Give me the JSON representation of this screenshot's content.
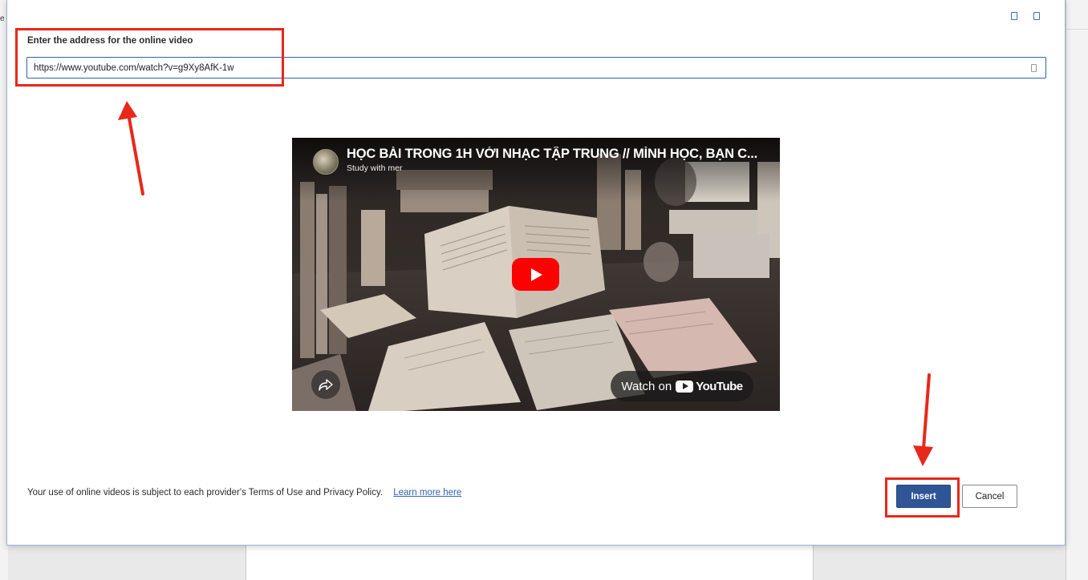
{
  "background": {
    "left_tab_stub": "e"
  },
  "dialog": {
    "window_icons": [
      "restore-icon",
      "close-icon"
    ],
    "address_label": "Enter the address for the online video",
    "url_value": "https://www.youtube.com/watch?v=g9Xy8AfK-1w",
    "input_icon": "clipboard-icon",
    "video": {
      "title": "HỌC BÀI TRONG 1H VỚI NHẠC TẬP TRUNG // MÌNH HỌC, BẠN C...",
      "channel": "Study with mer",
      "watch_on_label": "Watch on",
      "watch_on_brand": "YouTube",
      "play_icon": "play-icon",
      "share_icon": "share-icon"
    },
    "terms_text": "Your use of online videos is subject to each provider's Terms of Use and Privacy Policy.",
    "learn_more_label": "Learn more here",
    "insert_label": "Insert",
    "cancel_label": "Cancel"
  },
  "annotations": {
    "highlight_color": "#e8281a",
    "accent_color": "#2f5597",
    "link_color": "#2f63b0"
  }
}
